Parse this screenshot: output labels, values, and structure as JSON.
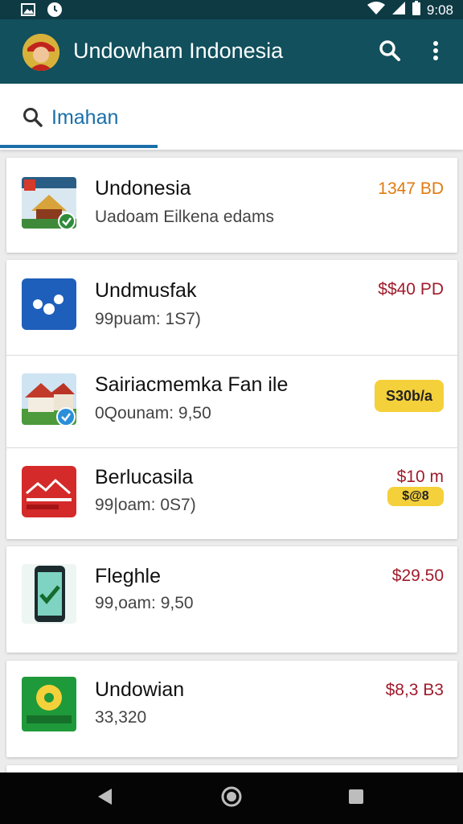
{
  "status_bar": {
    "time": "9:08"
  },
  "app_bar": {
    "title": "Undowham Indonesia"
  },
  "search_tab": {
    "label": "Imahan"
  },
  "items": [
    {
      "title": "Undonesia",
      "subtitle": "Uadoam Eilkena edams",
      "price": "1347 BD"
    },
    {
      "title": "Undmusfak",
      "subtitle": "99puam: 1S7)",
      "price": "$$40 PD"
    },
    {
      "title": "Sairiacmemka Fan ile",
      "subtitle": "0Qounam: 9,50",
      "badge": "S30b/a"
    },
    {
      "title": "Berlucasila",
      "subtitle": "99|oam: 0S7)",
      "price": "$10 m",
      "badge": "$@8"
    },
    {
      "title": "Fleghle",
      "subtitle": "99,oam: 9,50",
      "price": "$29.50"
    },
    {
      "title": "Undowian",
      "subtitle": "33,320",
      "price": "$8,3 B3"
    }
  ],
  "icons": {
    "status": [
      "gallery-icon",
      "alarm-icon",
      "wifi-icon",
      "signal-icon",
      "battery-icon"
    ],
    "app_bar": [
      "search-icon",
      "more-vert-icon"
    ],
    "nav": [
      "back-icon",
      "home-icon",
      "recents-icon"
    ]
  },
  "colors": {
    "app_bar": "#11505c",
    "status_bar": "#0e3a44",
    "accent": "#1a6fa8",
    "price": "#a01c2c",
    "price_alt": "#e07a10",
    "badge": "#f4d03a"
  }
}
